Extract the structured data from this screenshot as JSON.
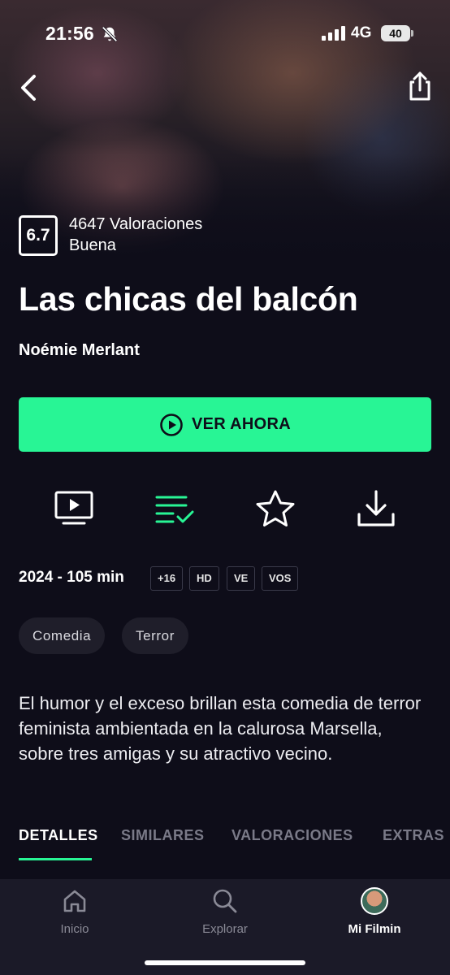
{
  "status_bar": {
    "time": "21:56",
    "network": "4G",
    "battery": "40"
  },
  "icons": {
    "back": "chevron-left-icon",
    "share": "share-icon",
    "play": "play-circle-icon",
    "trailer": "tv-play-icon",
    "watchlist": "list-check-icon",
    "favorite": "star-icon",
    "download": "download-icon"
  },
  "movie": {
    "rating": "6.7",
    "ratings_count": "4647 Valoraciones",
    "rating_label": "Buena",
    "title": "Las chicas del balcón",
    "director": "Noémie Merlant",
    "watch_label": "VER AHORA",
    "year_duration": "2024 - 105 min",
    "badges": [
      "+16",
      "HD",
      "VE",
      "VOS"
    ],
    "genres": [
      "Comedia",
      "Terror"
    ],
    "synopsis": "El humor y el exceso brillan esta comedia de terror feminista ambientada en la calurosa Marsella, sobre tres amigas y su atractivo vecino."
  },
  "tabs": [
    "DETALLES",
    "SIMILARES",
    "VALORACIONES",
    "EXTRAS"
  ],
  "active_tab": "DETALLES",
  "bottom_nav": [
    {
      "label": "Inicio",
      "icon": "home-icon"
    },
    {
      "label": "Explorar",
      "icon": "search-icon"
    },
    {
      "label": "Mi Filmin",
      "icon": "avatar"
    }
  ],
  "colors": {
    "accent": "#28f595",
    "background": "#0e0d19",
    "nav_background": "#1b1a28"
  }
}
